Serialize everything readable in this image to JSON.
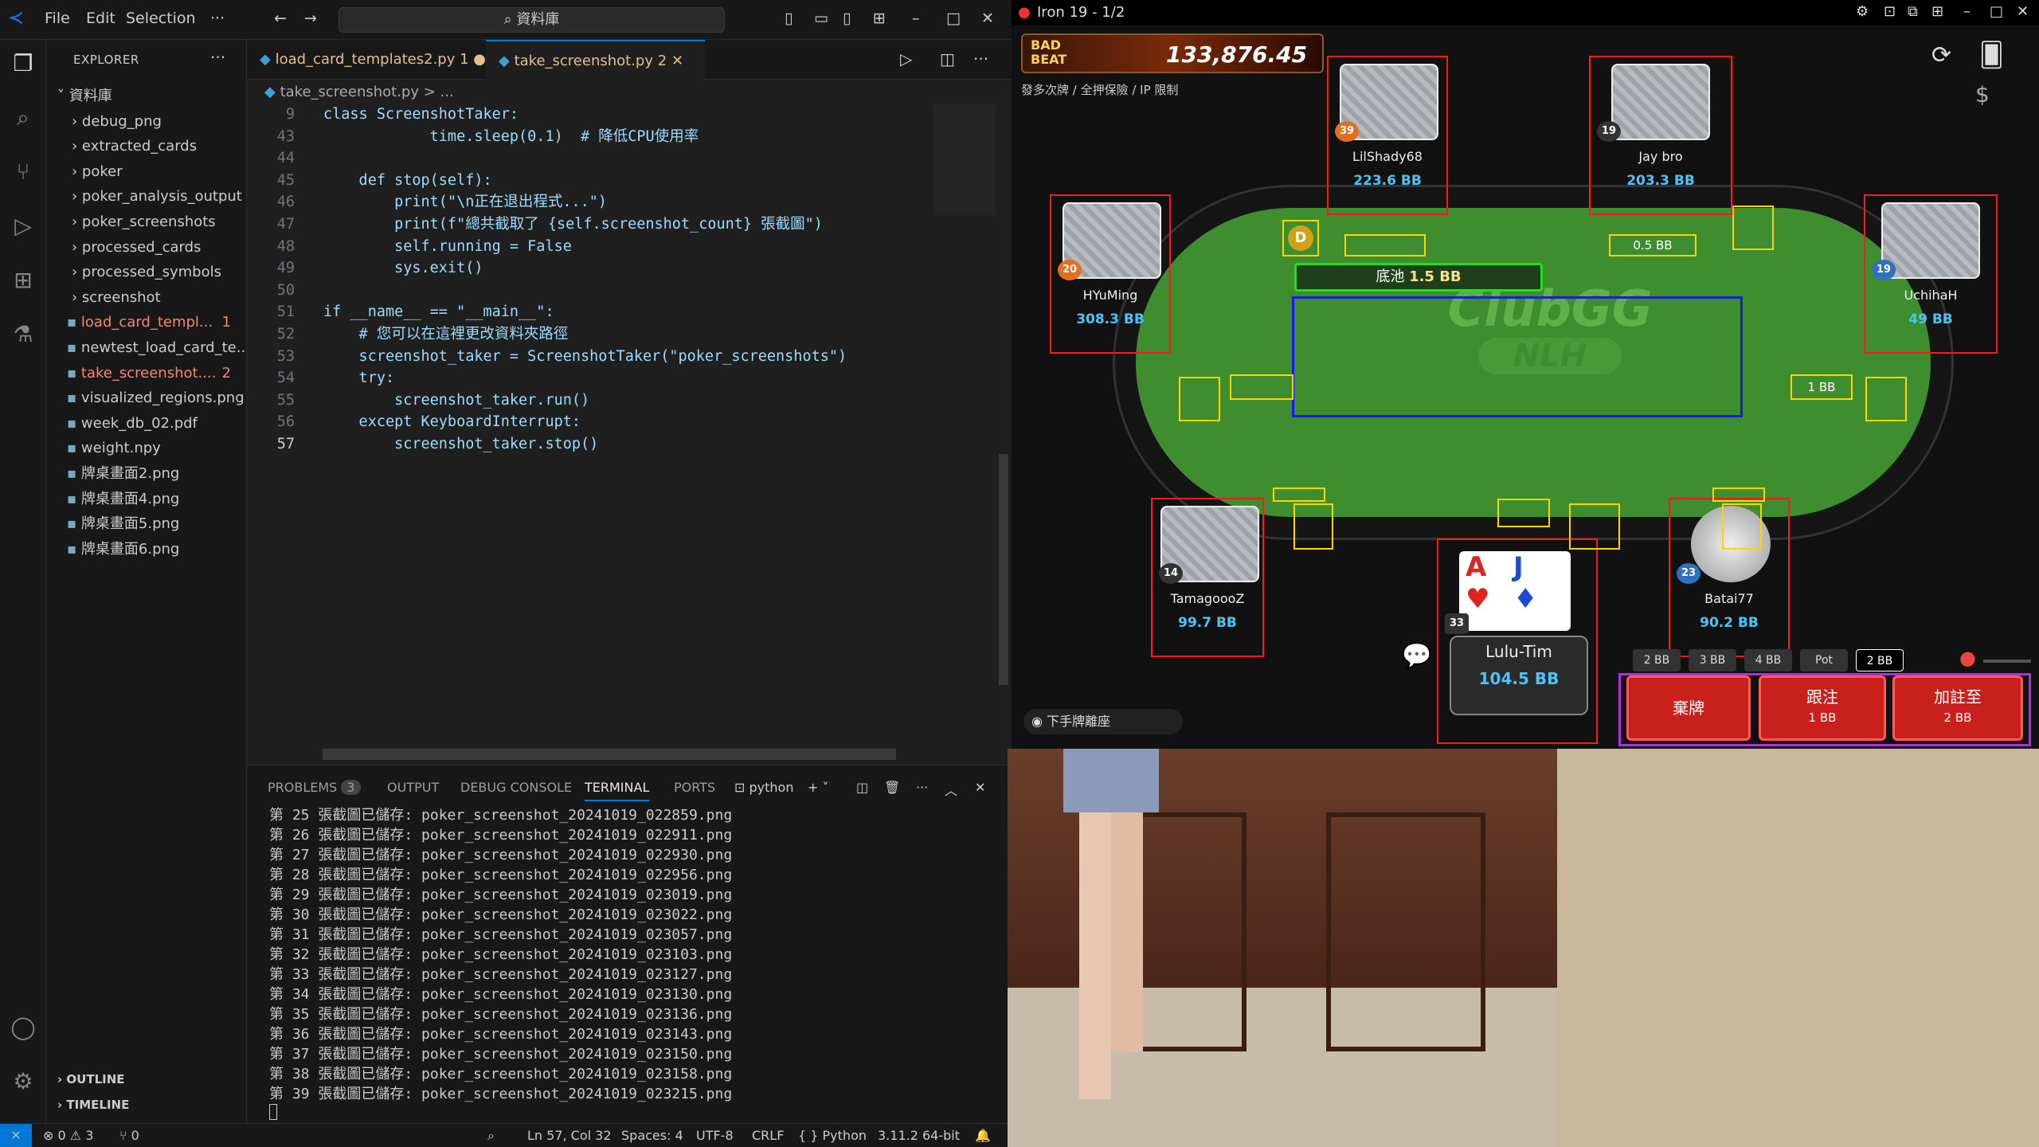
{
  "vscode": {
    "menu": [
      "File",
      "Edit",
      "Selection",
      "···"
    ],
    "search": "資料庫",
    "explorer_title": "EXPLORER",
    "root": "資料庫",
    "tree": [
      {
        "label": "debug_png",
        "type": "folder"
      },
      {
        "label": "extracted_cards",
        "type": "folder"
      },
      {
        "label": "poker",
        "type": "folder"
      },
      {
        "label": "poker_analysis_output",
        "type": "folder"
      },
      {
        "label": "poker_screenshots",
        "type": "folder"
      },
      {
        "label": "processed_cards",
        "type": "folder"
      },
      {
        "label": "processed_symbols",
        "type": "folder"
      },
      {
        "label": "screenshot",
        "type": "folder"
      },
      {
        "label": "load_card_templ...",
        "type": "file",
        "badge": "1",
        "modified": true
      },
      {
        "label": "newtest_load_card_te...",
        "type": "file"
      },
      {
        "label": "take_screenshot....",
        "type": "file",
        "badge": "2",
        "modified": true
      },
      {
        "label": "visualized_regions.png",
        "type": "file"
      },
      {
        "label": "week_db_02.pdf",
        "type": "file"
      },
      {
        "label": "weight.npy",
        "type": "file"
      },
      {
        "label": "牌桌畫面2.png",
        "type": "file"
      },
      {
        "label": "牌桌畫面4.png",
        "type": "file"
      },
      {
        "label": "牌桌畫面5.png",
        "type": "file"
      },
      {
        "label": "牌桌畫面6.png",
        "type": "file"
      }
    ],
    "outline": "OUTLINE",
    "timeline": "TIMELINE",
    "tabs": [
      {
        "label": "load_card_templates2.py 1",
        "active": false
      },
      {
        "label": "take_screenshot.py 2",
        "active": true
      }
    ],
    "breadcrumb": "take_screenshot.py > ...",
    "code": [
      [
        "9",
        "class ScreenshotTaker:"
      ],
      [
        "43",
        "            time.sleep(0.1)  # 降低CPU使用率"
      ],
      [
        "44",
        ""
      ],
      [
        "45",
        "    def stop(self):"
      ],
      [
        "46",
        "        print(\"\\n正在退出程式...\")"
      ],
      [
        "47",
        "        print(f\"總共截取了 {self.screenshot_count} 張截圖\")"
      ],
      [
        "48",
        "        self.running = False"
      ],
      [
        "49",
        "        sys.exit()"
      ],
      [
        "50",
        ""
      ],
      [
        "51",
        "if __name__ == \"__main__\":"
      ],
      [
        "52",
        "    # 您可以在這裡更改資料夾路徑"
      ],
      [
        "53",
        "    screenshot_taker = ScreenshotTaker(\"poker_screenshots\")"
      ],
      [
        "54",
        "    try:"
      ],
      [
        "55",
        "        screenshot_taker.run()"
      ],
      [
        "56",
        "    except KeyboardInterrupt:"
      ],
      [
        "57",
        "        screenshot_taker.stop()"
      ]
    ],
    "panel_tabs": [
      "PROBLEMS",
      "OUTPUT",
      "DEBUG CONSOLE",
      "TERMINAL",
      "PORTS"
    ],
    "problems_count": "3",
    "terminal_name": "python",
    "terminal_lines": [
      "第 25 張截圖已儲存: poker_screenshot_20241019_022859.png",
      "第 26 張截圖已儲存: poker_screenshot_20241019_022911.png",
      "第 27 張截圖已儲存: poker_screenshot_20241019_022930.png",
      "第 28 張截圖已儲存: poker_screenshot_20241019_022956.png",
      "第 29 張截圖已儲存: poker_screenshot_20241019_023019.png",
      "第 30 張截圖已儲存: poker_screenshot_20241019_023022.png",
      "第 31 張截圖已儲存: poker_screenshot_20241019_023057.png",
      "第 32 張截圖已儲存: poker_screenshot_20241019_023103.png",
      "第 33 張截圖已儲存: poker_screenshot_20241019_023127.png",
      "第 34 張截圖已儲存: poker_screenshot_20241019_023130.png",
      "第 35 張截圖已儲存: poker_screenshot_20241019_023136.png",
      "第 36 張截圖已儲存: poker_screenshot_20241019_023143.png",
      "第 37 張截圖已儲存: poker_screenshot_20241019_023150.png",
      "第 38 張截圖已儲存: poker_screenshot_20241019_023158.png",
      "第 39 張截圖已儲存: poker_screenshot_20241019_023215.png"
    ],
    "status": {
      "errors": "⊗ 0 ⚠ 3",
      "ports": "⑂ 0",
      "cursor": "Ln 57, Col 32",
      "spaces": "Spaces: 4",
      "encoding": "UTF-8",
      "eol": "CRLF",
      "language": "{ } Python",
      "interpreter": "3.11.2 64-bit"
    }
  },
  "poker": {
    "window_title": "Iron 19 - 1/2",
    "jackpot": "133,876.45",
    "jackpot_brand": "BAD BEAT",
    "table_info": "發多次牌 / 全押保險 / IP 限制",
    "pot_label": "底池",
    "pot_value": "1.5 BB",
    "brand": "ClubGG",
    "game": "NLH",
    "players": [
      {
        "name": "LilShady68",
        "stack": "223.6 BB",
        "level": "39"
      },
      {
        "name": "Jay bro",
        "stack": "203.3 BB",
        "level": "19"
      },
      {
        "name": "HYuMing",
        "stack": "308.3 BB",
        "level": "20"
      },
      {
        "name": "UchihaH",
        "stack": "49 BB",
        "level": "19"
      },
      {
        "name": "TamagoooZ",
        "stack": "99.7 BB",
        "level": "14"
      },
      {
        "name": "Batai77",
        "stack": "90.2 BB",
        "level": "23"
      },
      {
        "name": "Lulu-Tim",
        "stack": "104.5 BB",
        "level": "33"
      }
    ],
    "bets": [
      "0.5 BB",
      "1 BB"
    ],
    "hole_cards": [
      "A",
      "J"
    ],
    "bet_sizes": [
      "2 BB",
      "3 BB",
      "4 BB",
      "Pot",
      "2 BB"
    ],
    "sit_out": "下手牌離座",
    "actions": [
      {
        "label": "棄牌",
        "sub": ""
      },
      {
        "label": "跟注",
        "sub": "1 BB"
      },
      {
        "label": "加註至",
        "sub": "2 BB"
      }
    ],
    "dealer": "D"
  }
}
